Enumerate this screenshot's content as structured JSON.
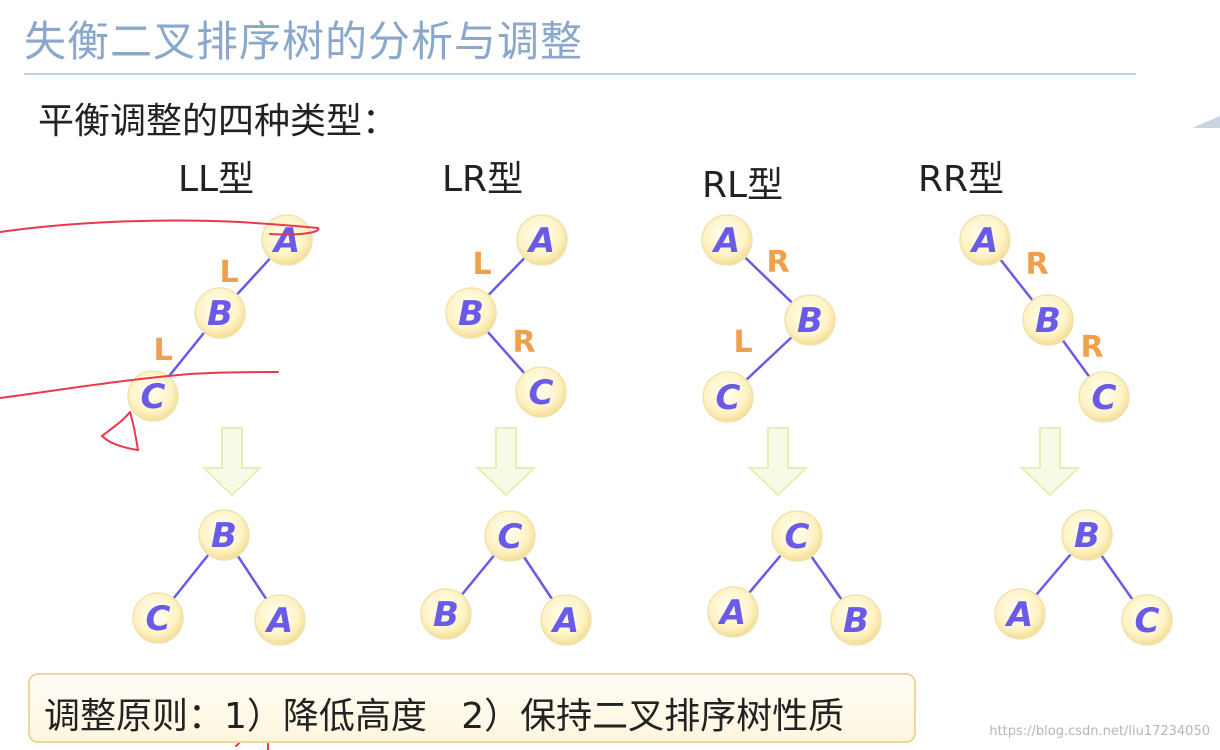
{
  "title": "失衡二叉排序树的分析与调整",
  "subtitle": "平衡调整的四种类型：",
  "types": [
    {
      "label": "LL型",
      "before": {
        "top": "A",
        "mid": "B",
        "bottom": "C",
        "edge1": "L",
        "edge2": "L"
      },
      "after": {
        "root": "B",
        "left": "C",
        "right": "A"
      }
    },
    {
      "label": "LR型",
      "before": {
        "top": "A",
        "mid": "B",
        "bottom": "C",
        "edge1": "L",
        "edge2": "R"
      },
      "after": {
        "root": "C",
        "left": "B",
        "right": "A"
      }
    },
    {
      "label": "RL型",
      "before": {
        "top": "A",
        "mid": "B",
        "bottom": "C",
        "edge1": "R",
        "edge2": "L"
      },
      "after": {
        "root": "C",
        "left": "A",
        "right": "B"
      }
    },
    {
      "label": "RR型",
      "before": {
        "top": "A",
        "mid": "B",
        "bottom": "C",
        "edge1": "R",
        "edge2": "R"
      },
      "after": {
        "root": "B",
        "left": "A",
        "right": "C"
      }
    }
  ],
  "principle": "调整原则：1）降低高度   2）保持二叉排序树性质",
  "watermark": "https://blog.csdn.net/liu17234050",
  "colors": {
    "node_text": "#6a5ae8",
    "edge_label": "#f0a04a",
    "node_fill": "#fff6c8",
    "edge_line": "#6a5ae8",
    "arrow": "#eef6c8",
    "annotation": "#e83a4a",
    "title": "#8aa7cc"
  }
}
